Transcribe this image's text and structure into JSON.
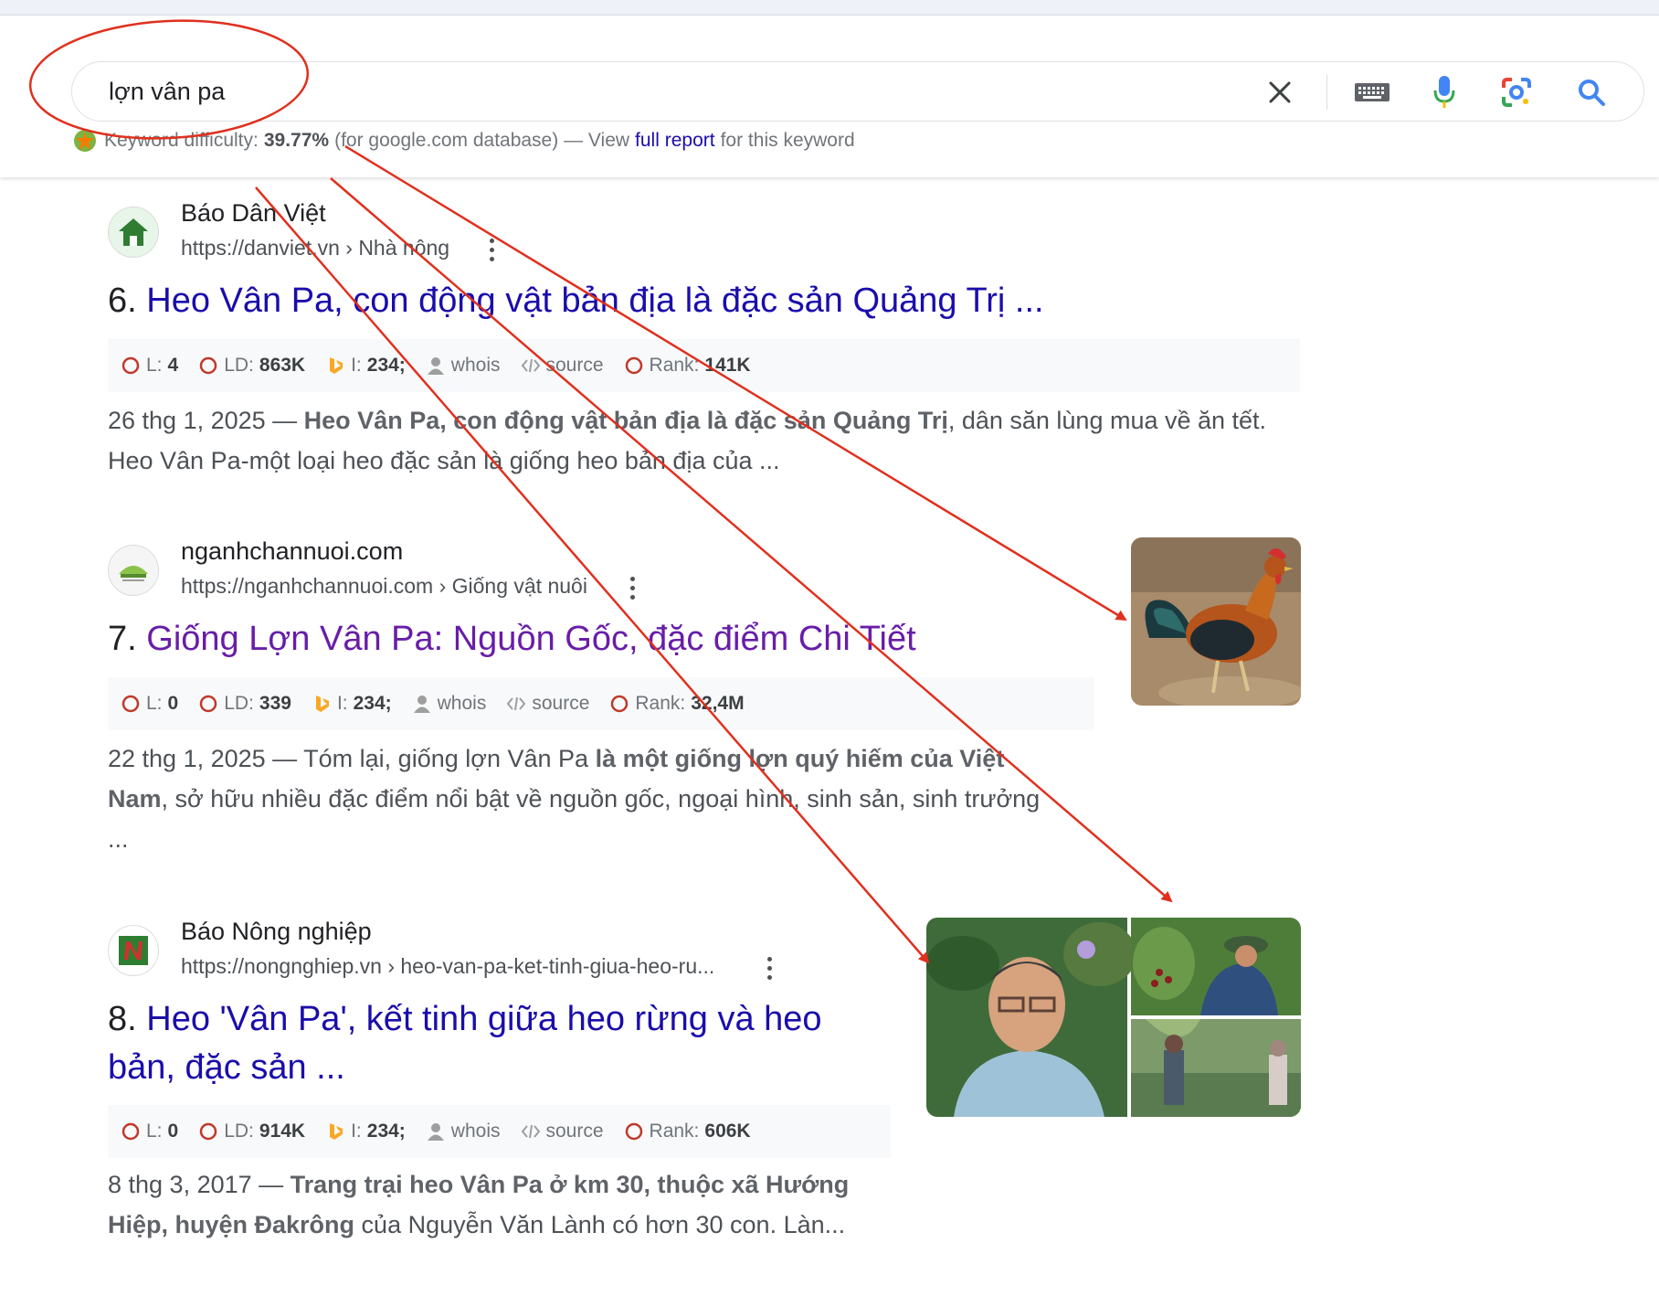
{
  "search": {
    "query": "lợn vân pa",
    "icons": [
      "close-icon",
      "keyboard-icon",
      "microphone-icon",
      "camera-lens-icon",
      "search-icon"
    ]
  },
  "keyword_difficulty": {
    "label": "Keyword difficulty:",
    "value": "39.77%",
    "database_note": "(for google.com database) — View",
    "link_text": "full report",
    "suffix": "for this keyword"
  },
  "results": [
    {
      "site_name": "Báo Dân Việt",
      "url": "https://danviet.vn › Nhà nông",
      "number": "6.",
      "title": "Heo Vân Pa, con động vật bản địa là đặc sản Quảng Trị ...",
      "seo": {
        "l_label": "L:",
        "l": "4",
        "ld_label": "LD:",
        "ld": "863K",
        "i_label": "I:",
        "i": "234;",
        "whois": "whois",
        "source": "source",
        "rank_label": "Rank:",
        "rank": "141K"
      },
      "snippet_date": "26 thg 1, 2025 —",
      "snippet_bold": "Heo Vân Pa, con động vật bản địa là đặc sản Quảng Trị",
      "snippet_rest": ", dân săn lùng mua về ăn tết. Heo Vân Pa-một loại heo đặc sản là giống heo bản địa của ..."
    },
    {
      "site_name": "nganhchannuoi.com",
      "url": "https://nganhchannuoi.com › Giống vật nuôi",
      "number": "7.",
      "title": "Giống Lợn Vân Pa: Nguồn Gốc, đặc điểm Chi Tiết",
      "seo": {
        "l_label": "L:",
        "l": "0",
        "ld_label": "LD:",
        "ld": "339",
        "i_label": "I:",
        "i": "234;",
        "whois": "whois",
        "source": "source",
        "rank_label": "Rank:",
        "rank": "32,4M"
      },
      "snippet_date": "22 thg 1, 2025 — Tóm lại, giống lợn Vân Pa",
      "snippet_bold": "là một giống lợn quý hiếm của Việt Nam",
      "snippet_rest": ", sở hữu nhiều đặc điểm nổi bật về nguồn gốc, ngoại hình, sinh sản, sinh trưởng ..."
    },
    {
      "site_name": "Báo Nông nghiệp",
      "url": "https://nongnghiep.vn › heo-van-pa-ket-tinh-giua-heo-ru...",
      "number": "8.",
      "title": "Heo 'Vân Pa', kết tinh giữa heo rừng và heo bản, đặc sản ...",
      "seo": {
        "l_label": "L:",
        "l": "0",
        "ld_label": "LD:",
        "ld": "914K",
        "i_label": "I:",
        "i": "234;",
        "whois": "whois",
        "source": "source",
        "rank_label": "Rank:",
        "rank": "606K"
      },
      "snippet_date": "8 thg 3, 2017 —",
      "snippet_bold": "Trang trại heo Vân Pa ở km 30, thuộc xã Hướng Hiệp, huyện Đakrông",
      "snippet_rest": " của Nguyễn Văn Lành có hơn 30 con. Làn..."
    }
  ],
  "colors": {
    "link": "#1a0dab",
    "visited_link": "#681da8",
    "annotation_red": "#e0301e"
  }
}
